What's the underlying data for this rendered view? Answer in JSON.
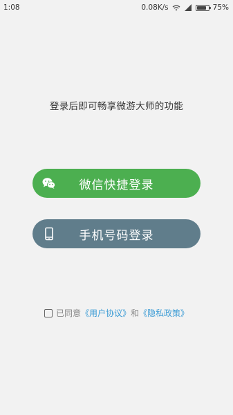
{
  "status_bar": {
    "time": "1:08",
    "network_speed": "0.08K/s",
    "battery_percent": "75%",
    "battery_level": 0.75
  },
  "main": {
    "subtitle": "登录后即可畅享微游大师的功能",
    "wechat_login_label": "微信快捷登录",
    "phone_login_label": "手机号码登录",
    "wechat_color": "#4caf50",
    "phone_color": "#607d8b"
  },
  "agreement": {
    "prefix": "已同意",
    "user_agreement": "《用户协议》",
    "conjunction": "和",
    "privacy_policy": "《隐私政策》",
    "checked": false,
    "link_color": "#3a9bd5"
  },
  "icons": {
    "wechat": "wechat-icon",
    "phone": "phone-icon",
    "wifi": "wifi-icon",
    "signal": "signal-icon",
    "battery": "battery-icon"
  }
}
